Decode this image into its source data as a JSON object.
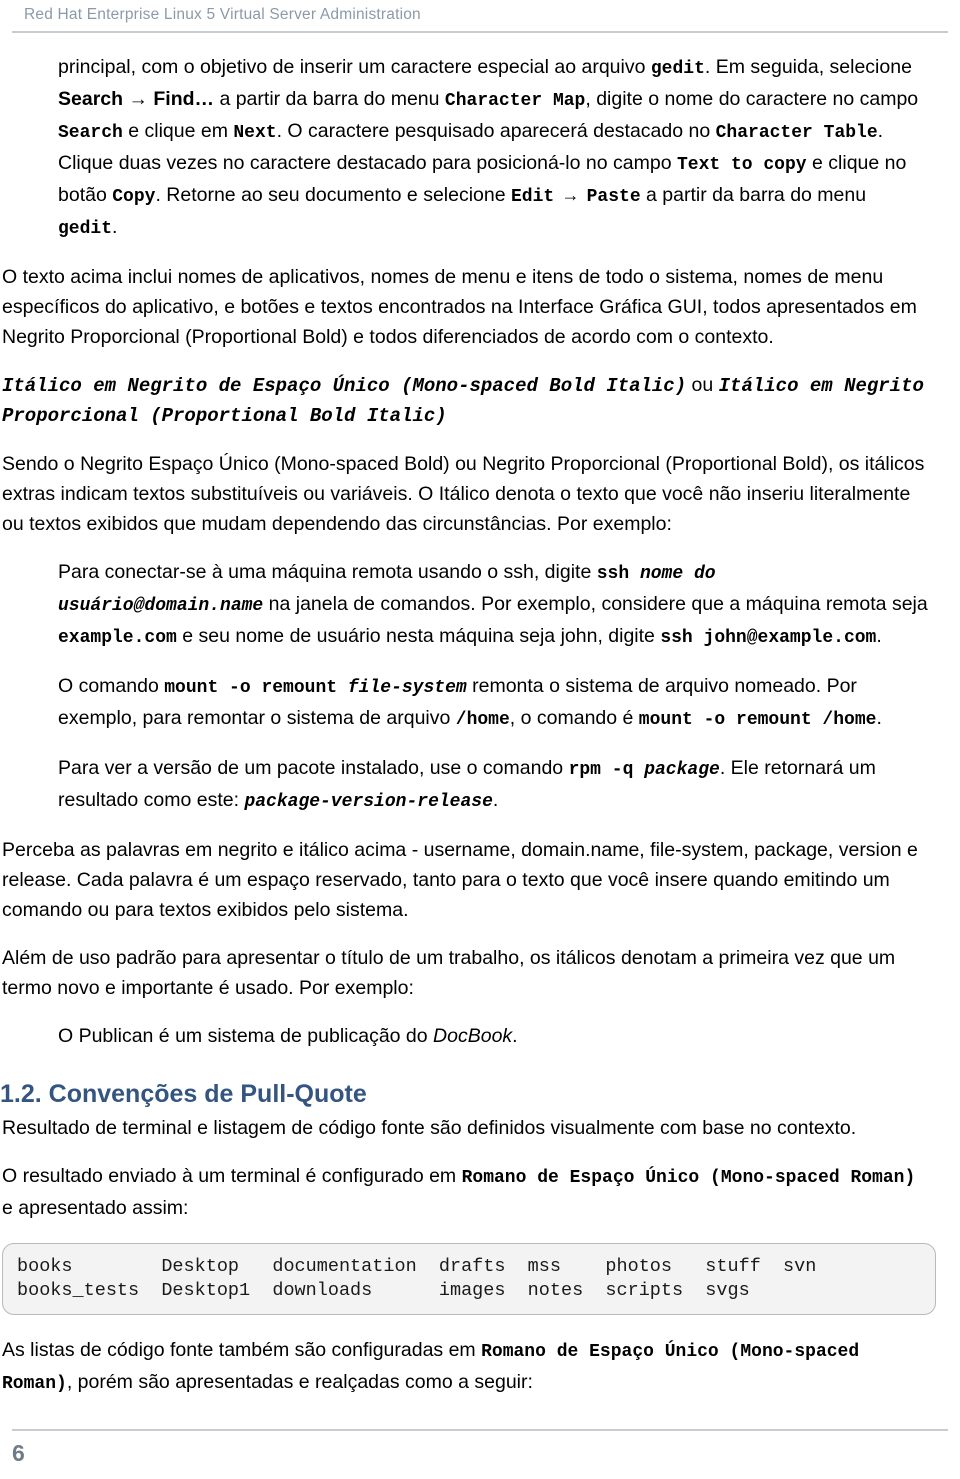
{
  "header": {
    "title": "Red Hat Enterprise Linux 5 Virtual Server Administration",
    "color": "#8c9aa8"
  },
  "footer": {
    "page_number": "6"
  },
  "theme": {
    "heading_color": "#33557f",
    "rule_color": "#c8ccd1",
    "code_background": "#f3f3f3",
    "code_border": "#b9b9b9"
  },
  "paragraph_1": {
    "s1": "principal, com o objetivo de inserir um caractere especial ao arquivo ",
    "gedit_1": "gedit",
    "s2": ". Em seguida, selecione ",
    "search_find": "Search → Find…",
    "s3": " a partir da barra do menu ",
    "character_map": "Character Map",
    "s4": ", digite o nome do caractere no campo ",
    "search_field": "Search",
    "s5": " e clique em ",
    "next_btn": "Next",
    "s6": ". O caractere pesquisado aparecerá destacado no ",
    "character_table": "Character Table",
    "s7": ". Clique duas vezes no caractere destacado para posicioná-lo no campo ",
    "text_to_copy": "Text to copy",
    "s8": " e clique no botão ",
    "copy_btn": "Copy",
    "s9": ". Retorne ao seu documento e selecione ",
    "edit_paste": "Edit → Paste",
    "s10": " a partir da barra do menu ",
    "gedit_2": "gedit",
    "s11": "."
  },
  "paragraph_2": {
    "text": "O texto acima inclui nomes de aplicativos, nomes de menu e itens de todo o sistema, nomes de menu específicos do aplicativo, e botões e textos encontrados na Interface Gráfica GUI, todos apresentados em Negrito Proporcional (Proportional Bold) e todos diferenciados de acordo com o contexto."
  },
  "emphasis_line": {
    "mono_bold_italic": "Itálico em Negrito de Espaço Único (Mono-spaced Bold Italic)",
    "connector": " ou ",
    "proportional_bold_italic": "Itálico em Negrito Proporcional (Proportional Bold Italic)"
  },
  "paragraph_3": {
    "text": "Sendo o Negrito Espaço Único (Mono-spaced Bold) ou Negrito Proporcional (Proportional Bold), os itálicos extras indicam textos substituíveis ou variáveis. O Itálico denota o texto que você não inseriu literalmente ou textos exibidos que mudam dependendo das circunstâncias. Por exemplo:"
  },
  "example_ssh": {
    "s1": "Para conectar-se à uma máquina remota usando o ssh, digite ",
    "cmd_ssh": "ssh ",
    "arg_user": "nome do usuário@domain.name",
    "s2": " na janela de comandos. Por exemplo, considere que a máquina remota seja ",
    "host": "example.com",
    "s3": " e seu nome de usuário nesta máquina seja john, digite ",
    "cmd_ssh_2": "ssh john@example.com",
    "s4": "."
  },
  "example_mount": {
    "s1": "O comando ",
    "cmd": "mount -o remount ",
    "arg": "file-system",
    "s2": " remonta o sistema de arquivo nomeado. Por exemplo, para remontar o sistema de arquivo ",
    "path": "/home",
    "s3": ", o comando é ",
    "cmd_2": "mount -o remount /home",
    "s4": "."
  },
  "example_rpm": {
    "s1": "Para ver a versão de um pacote instalado, use o comando ",
    "cmd": "rpm -q ",
    "arg": "package",
    "s2": ". Ele retornará um resultado como este: ",
    "result": "package-version-release",
    "s3": "."
  },
  "paragraph_4": {
    "text": "Perceba as palavras em negrito e itálico acima - username, domain.name, file-system, package, version e release. Cada palavra é um espaço reservado, tanto para o texto que você insere quando emitindo um comando ou para textos exibidos pelo sistema."
  },
  "paragraph_5": {
    "text": "Além de uso padrão para apresentar o título de um trabalho, os itálicos denotam a primeira vez que um termo novo e importante é usado. Por exemplo:"
  },
  "example_publican": {
    "s1": "O Publican é um sistema de publicação do ",
    "italic": "DocBook",
    "s2": "."
  },
  "section": {
    "title": "1.2. Convenções de Pull-Quote",
    "intro": "Resultado de terminal e listagem de código fonte são definidos visualmente com base no contexto.",
    "lead_s1": "O resultado enviado à um terminal é configurado em ",
    "lead_mono": "Romano de Espaço Único (Mono-spaced Roman)",
    "lead_s2": " e apresentado assim:",
    "trailing_s1": "As listas de código fonte também são configuradas em ",
    "trailing_mono": "Romano de Espaço Único (Mono-spaced Roman)",
    "trailing_s2": ", porém são apresentadas e realçadas como a seguir:"
  },
  "screen_output": {
    "lines": "books        Desktop   documentation  drafts  mss    photos   stuff  svn\nbooks_tests  Desktop1  downloads      images  notes  scripts  svgs"
  }
}
